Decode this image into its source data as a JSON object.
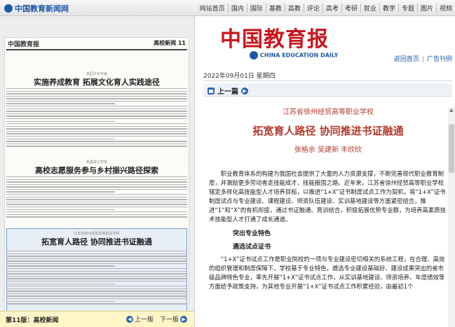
{
  "site": {
    "logo_text": "中国教育新闻网",
    "nav": [
      "网站首页",
      "国内",
      "国际",
      "基教",
      "高教",
      "评论",
      "高考",
      "考研",
      "就业",
      "教学",
      "专题",
      "图片",
      "视频"
    ]
  },
  "paper": {
    "title": "中国教育报",
    "section": "高校新闻 11",
    "articles": [
      {
        "kicker": "校园文化专版",
        "title": "实施养成教育  拓展文化育人实践途径"
      },
      {
        "kicker": "新疆理工学院",
        "title": "高校志愿服务参与乡村振兴路径探索"
      },
      {
        "kicker": "江苏省徐州经贸高等职业学校",
        "title": "拓宽育人路径  协同推进书证融通"
      }
    ],
    "footer_label": "第11版：高校新闻",
    "prev_label": "上一版",
    "next_label": "下一版"
  },
  "masthead": {
    "title_cn": "中国教育报",
    "title_en": "CHINA EDUCATION DAILY",
    "link_home": "返回首页",
    "link_ad": "广告刊例"
  },
  "dateline": "2022年09月01日  星期四",
  "prev_article": "上一篇",
  "article": {
    "school": "江苏省徐州经贸高等职业学校",
    "headline": "拓宽育人路径  协同推进书证融通",
    "authors": "张格余  吴建新  丰欣欣",
    "para1": "职业教育体系的构建为我国社会提供了大量的人力资源支撑，不断完善现代职业教育制度，并激励更多劳动者走技能成才、技能报国之路。近年来，江苏省徐州经贸高等职业学校辖定多样化高技能型人才培养目标，以推进“1+X”证书制度试点工作为契机，将“1+X”证书制度试点与专业建设、课程建设、师资队伍建设、实训基地建设等方面紧密结合，推进“1”和“X”的有机衔接，通过书证融通、育训结合，积极拓展优势专业群，为培养高素质技术技能型人才打通了成长通道。",
    "sub1": "突出专业特色",
    "sub2": "遴选试点证书",
    "para2": "“1+X”证书试点工作是职业院校的一项与专业建设密切相关的系统工程，在合理、高效的组织管理和制度保障下，学校基于专业特色，遴选专业建设基础好、建设成果突出的省市级品牌特色专业，率先开展“1+X”证书试点工作，从实训基地建设、师资培养、年度绩效等方面给予政策支持，为其他专业开展“1+X”证书试点工作积累经验，由最初1个"
  }
}
